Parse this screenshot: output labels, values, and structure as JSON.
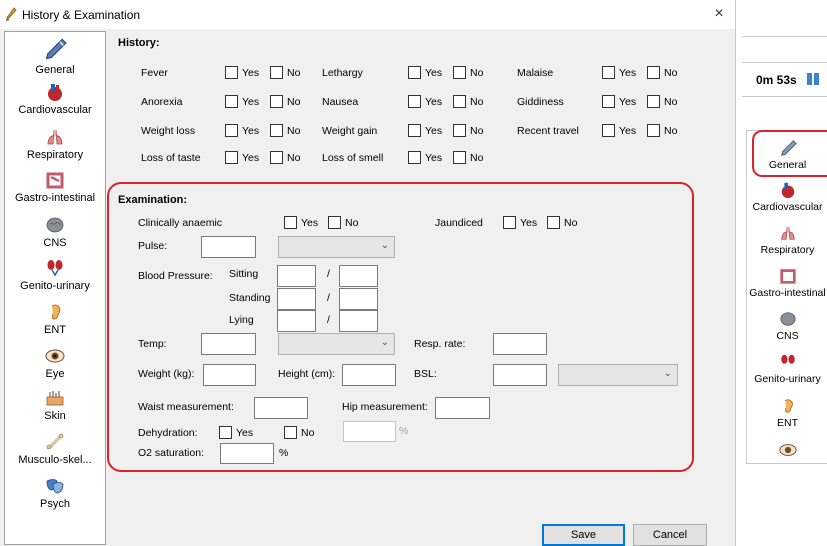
{
  "window": {
    "title": "History & Examination",
    "close": "×"
  },
  "sidebar": {
    "items": [
      {
        "label": "General",
        "icon": "pen-icon"
      },
      {
        "label": "Cardiovascular",
        "icon": "heart-icon"
      },
      {
        "label": "Respiratory",
        "icon": "lungs-icon"
      },
      {
        "label": "Gastro-intestinal",
        "icon": "intestine-icon"
      },
      {
        "label": "CNS",
        "icon": "brain-icon"
      },
      {
        "label": "Genito-urinary",
        "icon": "kidney-icon"
      },
      {
        "label": "ENT",
        "icon": "ear-icon"
      },
      {
        "label": "Eye",
        "icon": "eye-icon"
      },
      {
        "label": "Skin",
        "icon": "skin-icon"
      },
      {
        "label": "Musculo-skel...",
        "icon": "bone-icon"
      },
      {
        "label": "Psych",
        "icon": "mask-icon"
      }
    ]
  },
  "history": {
    "title": "History:",
    "yes": "Yes",
    "no": "No",
    "items": [
      "Fever",
      "Lethargy",
      "Malaise",
      "Anorexia",
      "Nausea",
      "Giddiness",
      "Weight loss",
      "Weight gain",
      "Recent travel",
      "Loss of taste",
      "Loss of smell"
    ]
  },
  "exam": {
    "title": "Examination:",
    "clinically_anaemic": "Clinically anaemic",
    "jaundiced": "Jaundiced",
    "pulse": "Pulse:",
    "bp": "Blood Pressure:",
    "sitting": "Sitting",
    "standing": "Standing",
    "lying": "Lying",
    "slash": "/",
    "temp": "Temp:",
    "resp_rate": "Resp. rate:",
    "weight": "Weight (kg):",
    "height": "Height (cm):",
    "bsl": "BSL:",
    "waist": "Waist measurement:",
    "hip": "Hip measurement:",
    "dehydration": "Dehydration:",
    "percent": "%",
    "o2": "O2 saturation:"
  },
  "buttons": {
    "save": "Save",
    "cancel": "Cancel"
  },
  "right_panel": {
    "timer": "0m 53s",
    "items": [
      "General",
      "Cardiovascular",
      "Respiratory",
      "Gastro-intestinal",
      "CNS",
      "Genito-urinary",
      "ENT"
    ]
  },
  "colors": {
    "highlight": "#d9242c",
    "accent": "#0078d7"
  }
}
